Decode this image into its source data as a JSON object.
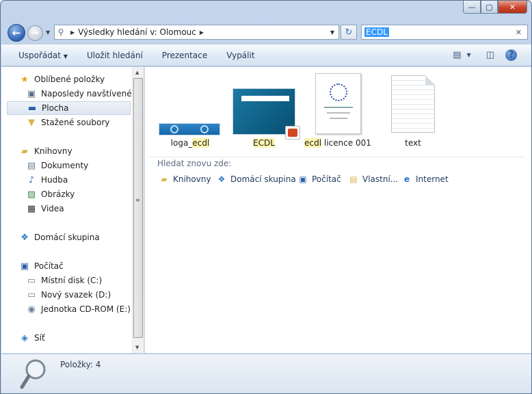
{
  "window": {
    "min": "—",
    "max": "▢",
    "close": "✕"
  },
  "address": {
    "segments": [
      "Výsledky hledání v: Olomouc"
    ]
  },
  "search": {
    "value": "ECDL"
  },
  "toolbar": {
    "organize": "Uspořádat",
    "save_search": "Uložit hledání",
    "slideshow": "Prezentace",
    "burn": "Vypálit"
  },
  "nav": {
    "favorites": "Oblíbené položky",
    "recent": "Naposledy navštívené",
    "desktop": "Plocha",
    "downloads": "Stažené soubory",
    "libraries": "Knihovny",
    "documents": "Dokumenty",
    "music": "Hudba",
    "pictures": "Obrázky",
    "videos": "Videa",
    "homegroup": "Domácí skupina",
    "computer": "Počítač",
    "local_disk": "Místní disk (C:)",
    "new_volume": "Nový svazek (D:)",
    "cdrom": "Jednotka CD-ROM (E:)",
    "network": "Síť"
  },
  "files": [
    {
      "prefix": "loga_",
      "highlight": "ecdl",
      "suffix": ""
    },
    {
      "prefix": "",
      "highlight": "ECDL",
      "suffix": ""
    },
    {
      "prefix": "",
      "highlight": "ecdl",
      "suffix": " licence 001"
    },
    {
      "prefix": "text",
      "highlight": "",
      "suffix": ""
    }
  ],
  "search_again": {
    "label": "Hledat znovu zde:",
    "targets": [
      "Knihovny",
      "Domácí skupina",
      "Počítač",
      "Vlastní...",
      "Internet"
    ]
  },
  "status": {
    "items_count": "Položky: 4"
  },
  "colors": {
    "highlight": "#fff4b0",
    "selection": "#3399ff"
  }
}
